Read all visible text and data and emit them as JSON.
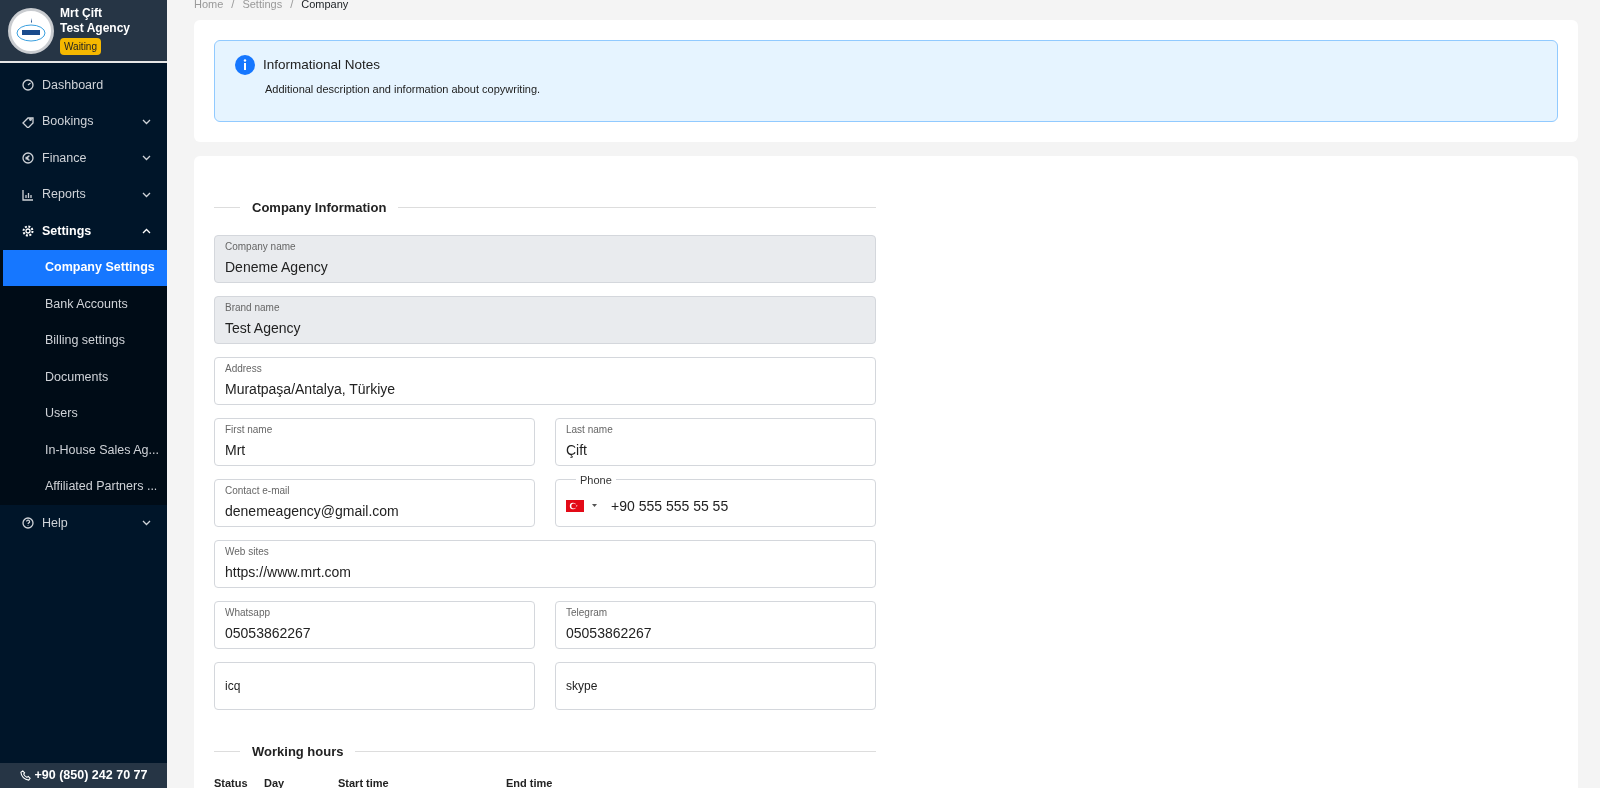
{
  "sidebar": {
    "user": {
      "name": "Mrt Çift",
      "agency": "Test Agency",
      "status": "Waiting"
    },
    "items": [
      {
        "label": "Dashboard",
        "kind": "link"
      },
      {
        "label": "Bookings",
        "kind": "group",
        "expanded": false
      },
      {
        "label": "Finance",
        "kind": "group",
        "expanded": false
      },
      {
        "label": "Reports",
        "kind": "group",
        "expanded": false
      },
      {
        "label": "Settings",
        "kind": "group",
        "expanded": true,
        "children": [
          {
            "label": "Company Settings",
            "selected": true
          },
          {
            "label": "Bank Accounts",
            "selected": false
          },
          {
            "label": "Billing settings",
            "selected": false
          },
          {
            "label": "Documents",
            "selected": false
          },
          {
            "label": "Users",
            "selected": false
          },
          {
            "label": "In-House Sales Ag...",
            "selected": false
          },
          {
            "label": "Affiliated Partners ...",
            "selected": false
          }
        ]
      },
      {
        "label": "Help",
        "kind": "group",
        "expanded": false
      }
    ],
    "phone": "+90 (850) 242 70 77"
  },
  "breadcrumb": {
    "separator": "/",
    "items": [
      "Home",
      "Settings",
      "Company"
    ]
  },
  "info": {
    "title": "Informational Notes",
    "text": "Additional description and information about copywriting."
  },
  "company_section": {
    "title": "Company Information",
    "rows": [
      [
        {
          "label": "Company name",
          "value": "Deneme Agency",
          "kind": "text",
          "disabled": true
        }
      ],
      [
        {
          "label": "Brand name",
          "value": "Test Agency",
          "kind": "text",
          "disabled": true
        }
      ],
      [
        {
          "label": "Address",
          "value": "Muratpaşa/Antalya, Türkiye",
          "kind": "text",
          "disabled": false
        }
      ],
      [
        {
          "label": "First name",
          "value": "Mrt",
          "kind": "text",
          "disabled": false
        },
        {
          "label": "Last name",
          "value": "Çift",
          "kind": "text",
          "disabled": false
        }
      ],
      [
        {
          "label": "Contact e-mail",
          "value": "denemeagency@gmail.com",
          "kind": "text",
          "disabled": false
        },
        {
          "label": "Phone",
          "value": "+90 555 555 55 55",
          "kind": "phone",
          "disabled": false
        }
      ],
      [
        {
          "label": "Web sites",
          "value": "https://www.mrt.com",
          "kind": "text",
          "disabled": false
        }
      ],
      [
        {
          "label": "Whatsapp",
          "value": "05053862267",
          "kind": "text",
          "disabled": false
        },
        {
          "label": "Telegram",
          "value": "05053862267",
          "kind": "text",
          "disabled": false
        }
      ],
      [
        {
          "placeholder": "icq",
          "kind": "plain",
          "disabled": false
        },
        {
          "placeholder": "skype",
          "kind": "plain",
          "disabled": false
        }
      ]
    ]
  },
  "working_hours": {
    "title": "Working hours",
    "columns": [
      "Status",
      "Day",
      "Start time",
      "End time"
    ]
  }
}
